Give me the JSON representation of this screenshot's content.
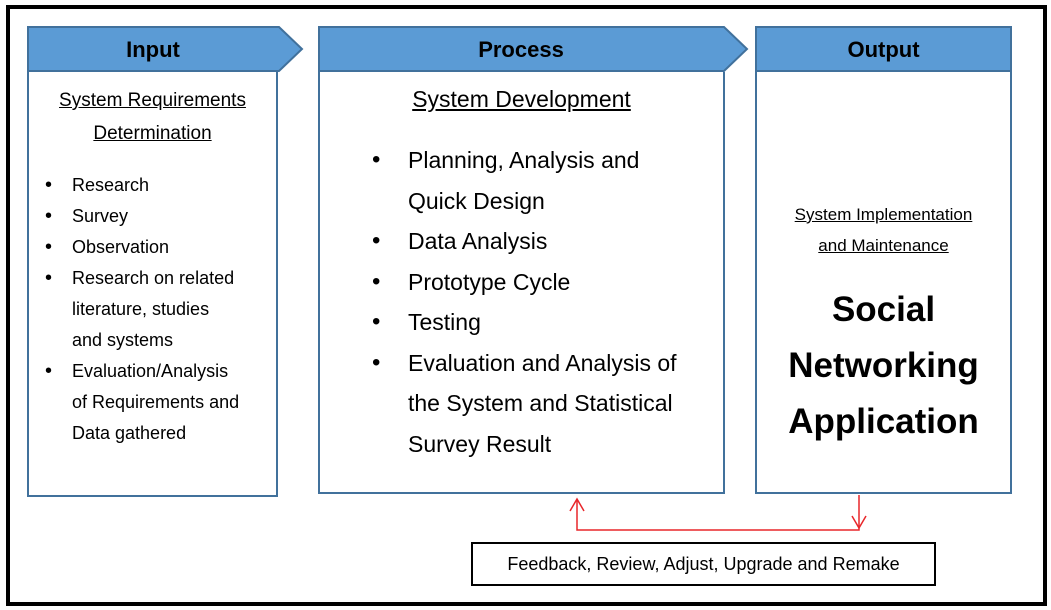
{
  "colors": {
    "header_fill": "#5b9bd5",
    "header_stroke": "#41719c",
    "connector": "#e8262a"
  },
  "input": {
    "header": "Input",
    "title_lines": [
      "System Requirements",
      "Determination"
    ],
    "items": [
      {
        "lines": [
          "Research"
        ]
      },
      {
        "lines": [
          "Survey"
        ]
      },
      {
        "lines": [
          "Observation"
        ]
      },
      {
        "lines": [
          "Research on related",
          "literature, studies",
          "and systems"
        ]
      },
      {
        "lines": [
          "Evaluation/Analysis",
          "of Requirements and",
          "Data gathered"
        ]
      }
    ]
  },
  "process": {
    "header": "Process",
    "title": "System Development",
    "items": [
      {
        "lines": [
          "Planning, Analysis and",
          "Quick Design"
        ]
      },
      {
        "lines": [
          "Data Analysis"
        ]
      },
      {
        "lines": [
          "Prototype Cycle"
        ]
      },
      {
        "lines": [
          "Testing"
        ]
      },
      {
        "lines": [
          "Evaluation and Analysis of",
          "the System and Statistical",
          "Survey Result"
        ]
      }
    ]
  },
  "output": {
    "header": "Output",
    "title_lines": [
      "System Implementation",
      "and Maintenance"
    ],
    "main_lines": [
      "Social",
      "Networking",
      "Application"
    ]
  },
  "feedback": {
    "label": "Feedback, Review, Adjust, Upgrade and Remake"
  }
}
